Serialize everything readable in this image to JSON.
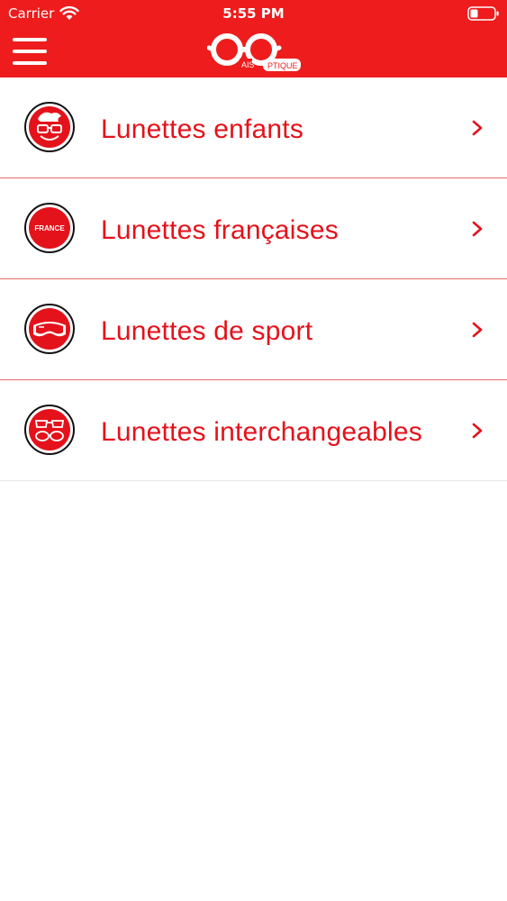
{
  "status_bar": {
    "carrier": "Carrier",
    "time": "5:55 PM"
  },
  "header": {
    "background": "#ee1c1c",
    "logo_text_left": "AIS",
    "logo_text_right": "PTIQUE",
    "menu_icon": "hamburger-icon"
  },
  "menu": {
    "items": [
      {
        "label": "Lunettes enfants",
        "icon": "kid-glasses-icon"
      },
      {
        "label": "Lunettes françaises",
        "icon": "france-badge-icon",
        "badge_text": "FRANCE"
      },
      {
        "label": "Lunettes de sport",
        "icon": "ski-goggles-icon"
      },
      {
        "label": "Lunettes interchangeables",
        "icon": "interchangeable-glasses-icon"
      }
    ]
  },
  "accent_color": "#e4121b"
}
